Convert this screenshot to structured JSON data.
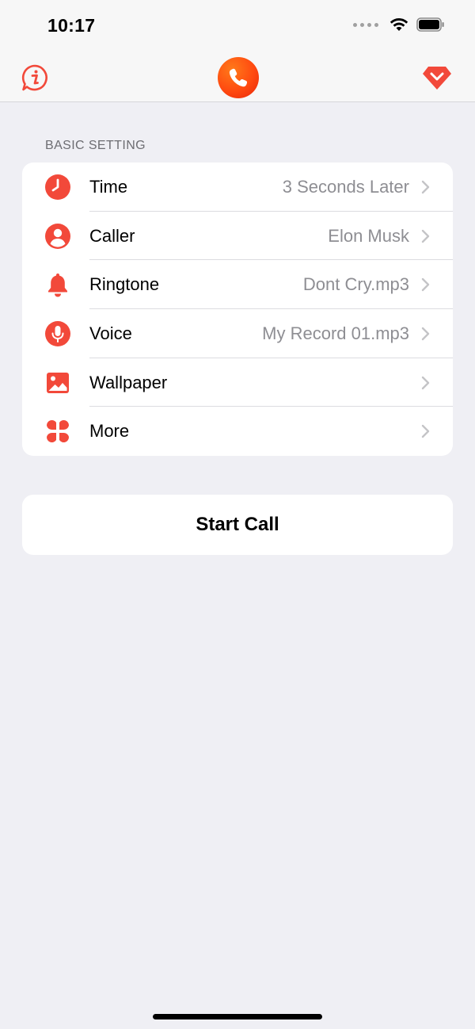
{
  "status_bar": {
    "time": "10:17"
  },
  "nav": {
    "left_icon": "info-bubble-icon",
    "center_icon": "phone-app-logo",
    "right_icon": "diamond-icon"
  },
  "section": {
    "header": "BASIC SETTING"
  },
  "settings": [
    {
      "icon": "clock-icon",
      "label": "Time",
      "value": "3 Seconds Later"
    },
    {
      "icon": "person-icon",
      "label": "Caller",
      "value": "Elon Musk"
    },
    {
      "icon": "bell-icon",
      "label": "Ringtone",
      "value": "Dont Cry.mp3"
    },
    {
      "icon": "microphone-icon",
      "label": "Voice",
      "value": "My Record 01.mp3"
    },
    {
      "icon": "image-icon",
      "label": "Wallpaper",
      "value": ""
    },
    {
      "icon": "clover-icon",
      "label": "More",
      "value": ""
    }
  ],
  "start_button": {
    "label": "Start Call"
  },
  "colors": {
    "accent": "#f2493a",
    "background": "#efeff4"
  }
}
